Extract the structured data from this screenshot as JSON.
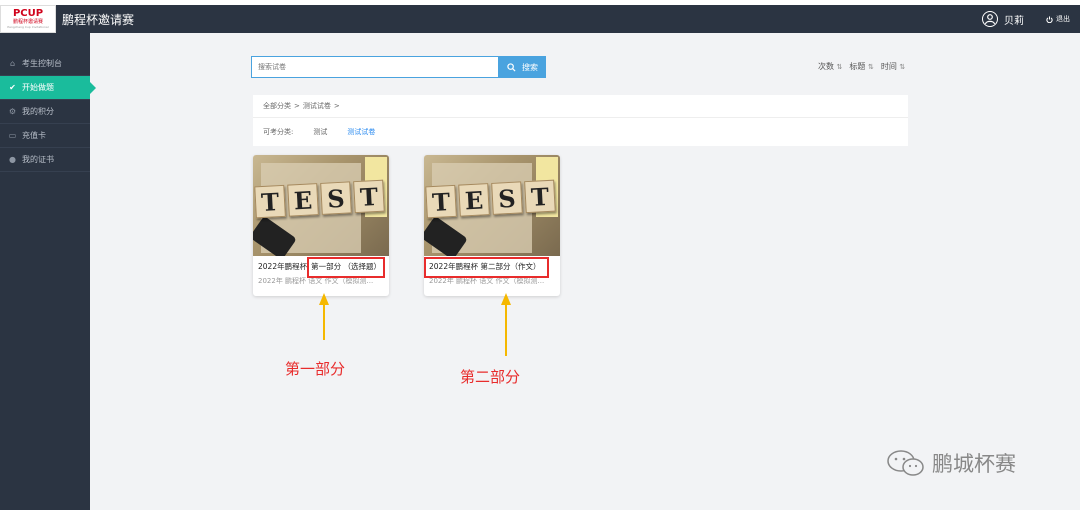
{
  "header": {
    "logo_mark": "PCUP",
    "logo_sub": "鹏程杯邀请赛",
    "logo_tiny": "Pengcheng Cup Invitational",
    "app_title": "鹏程杯邀请赛",
    "username": "贝莉",
    "logout_label": "退出"
  },
  "sidebar": {
    "items": [
      {
        "label": "考生控制台",
        "icon": "home-icon"
      },
      {
        "label": "开始做题",
        "icon": "check-circle-icon",
        "active": true
      },
      {
        "label": "我的积分",
        "icon": "gear-icon"
      },
      {
        "label": "充值卡",
        "icon": "card-icon"
      },
      {
        "label": "我的证书",
        "icon": "circle-icon"
      }
    ]
  },
  "search": {
    "placeholder": "搜索试卷",
    "button_label": "搜索"
  },
  "sort": {
    "items": [
      "次数",
      "标题",
      "时间"
    ]
  },
  "filter": {
    "breadcrumb": [
      "全部分类",
      ">",
      "测试试卷",
      ">"
    ],
    "category_label": "可考分类:",
    "categories": [
      {
        "label": "测试",
        "active": false
      },
      {
        "label": "测试试卷",
        "active": true
      }
    ]
  },
  "cards": [
    {
      "title_prefix": "2022年鹏程杯",
      "title_highlight": "第一部分 （选择题）",
      "subtitle": "2022年 鹏程杯 语文 作文（模拟测..."
    },
    {
      "title_prefix": "",
      "title_highlight": "2022年鹏程杯 第二部分（作文）",
      "subtitle": "2022年 鹏程杯 语文 作文（模拟测..."
    }
  ],
  "thumb_letters": [
    "T",
    "E",
    "S",
    "T"
  ],
  "annotations": {
    "first": "第一部分",
    "second": "第二部分"
  },
  "watermark": {
    "text": "鹏城杯赛"
  },
  "colors": {
    "sidebar_bg": "#2b3442",
    "active": "#1abc9c",
    "accent_blue": "#4aa3df",
    "annotation_red": "#e82c2c",
    "arrow_yellow": "#f5b800"
  }
}
